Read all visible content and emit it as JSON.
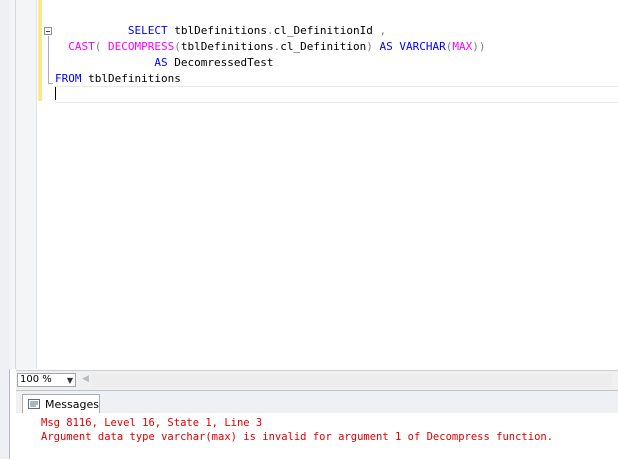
{
  "editor": {
    "lines": [
      [
        {
          "t": "           ",
          "c": "id"
        },
        {
          "t": "SELECT",
          "c": "kw"
        },
        {
          "t": " tblDefinitions",
          "c": "id"
        },
        {
          "t": ".",
          "c": "op"
        },
        {
          "t": "cl_DefinitionId ",
          "c": "id"
        },
        {
          "t": ",",
          "c": "op"
        }
      ],
      [
        {
          "t": "  ",
          "c": "id"
        },
        {
          "t": "CAST",
          "c": "fn"
        },
        {
          "t": "( ",
          "c": "op"
        },
        {
          "t": "DECOMPRESS",
          "c": "fn"
        },
        {
          "t": "(",
          "c": "op"
        },
        {
          "t": "tblDefinitions",
          "c": "id"
        },
        {
          "t": ".",
          "c": "op"
        },
        {
          "t": "cl_Definition",
          "c": "id"
        },
        {
          "t": ") ",
          "c": "op"
        },
        {
          "t": "AS",
          "c": "kw"
        },
        {
          "t": " ",
          "c": "id"
        },
        {
          "t": "VARCHAR",
          "c": "kw"
        },
        {
          "t": "(",
          "c": "op"
        },
        {
          "t": "MAX",
          "c": "fn"
        },
        {
          "t": "))",
          "c": "op"
        }
      ],
      [
        {
          "t": "               ",
          "c": "id"
        },
        {
          "t": "AS",
          "c": "kw"
        },
        {
          "t": " DecomressedTest",
          "c": "id"
        }
      ],
      [
        {
          "t": "FROM",
          "c": "kw"
        },
        {
          "t": " tblDefinitions",
          "c": "id"
        }
      ]
    ]
  },
  "zoom": {
    "value": "100 %"
  },
  "results": {
    "tab_label": "Messages",
    "messages": [
      "Msg 8116, Level 16, State 1, Line 3",
      "Argument data type varchar(max) is invalid for argument 1 of Decompress function."
    ]
  },
  "colors": {
    "keyword": "#0000ff",
    "function": "#ff00ff",
    "operator": "#808080",
    "error": "#e00000",
    "change_marker": "#f7e98e"
  }
}
